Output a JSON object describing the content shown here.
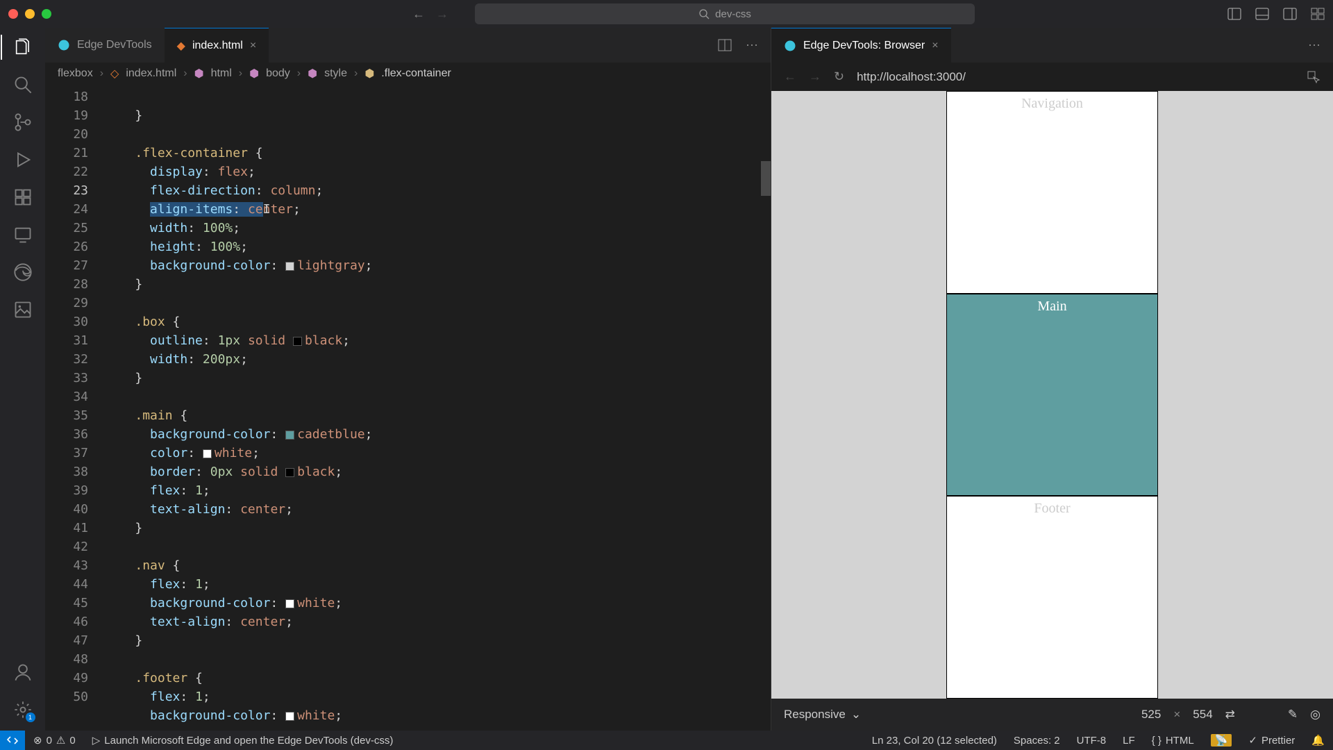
{
  "window": {
    "search_placeholder": "dev-css"
  },
  "tabs": {
    "left1": "Edge DevTools",
    "left2": "index.html",
    "right1": "Edge DevTools: Browser"
  },
  "breadcrumb": {
    "root": "flexbox",
    "file": "index.html",
    "html": "html",
    "body": "body",
    "style": "style",
    "selector": ".flex-container"
  },
  "gutter": [
    "18",
    "19",
    "20",
    "21",
    "22",
    "23",
    "24",
    "25",
    "26",
    "27",
    "28",
    "29",
    "30",
    "31",
    "32",
    "33",
    "34",
    "35",
    "36",
    "37",
    "38",
    "39",
    "40",
    "41",
    "42",
    "43",
    "44",
    "45",
    "46",
    "47",
    "48",
    "49",
    "50"
  ],
  "gutter_hl_index": 5,
  "code": {
    "l18": "    }",
    "l20a": "    ",
    "l20b": ".flex-container",
    "l20c": " {",
    "l21a": "      ",
    "l21p": "display",
    "l21v": "flex",
    "l22p": "flex-direction",
    "l22v": "column",
    "l23p": "align-items",
    "l23v": "center",
    "l24p": "width",
    "l24v": "100%",
    "l25p": "height",
    "l25v": "100%",
    "l26p": "background-color",
    "l26v": "lightgray",
    "l29s": ".box",
    "l30p": "outline",
    "l30v1": "1px",
    "l30v2": "solid",
    "l30v3": "black",
    "l31p": "width",
    "l31v": "200px",
    "l34s": ".main",
    "l35p": "background-color",
    "l35v": "cadetblue",
    "l36p": "color",
    "l36v": "white",
    "l37p": "border",
    "l37v1": "0px",
    "l37v2": "solid",
    "l37v3": "black",
    "l38p": "flex",
    "l38v": "1",
    "l39p": "text-align",
    "l39v": "center",
    "l42s": ".nav",
    "l43p": "flex",
    "l43v": "1",
    "l44p": "background-color",
    "l44v": "white",
    "l45p": "text-align",
    "l45v": "center",
    "l48s": ".footer",
    "l49p": "flex",
    "l49v": "1",
    "l50p": "background-color",
    "l50v": "white"
  },
  "browser": {
    "url": "http://localhost:3000/",
    "nav_label": "Navigation",
    "main_label": "Main",
    "footer_label": "Footer",
    "responsive": "Responsive",
    "width": "525",
    "times": "×",
    "height": "554"
  },
  "status": {
    "errors": "0",
    "warnings": "0",
    "launch": "Launch Microsoft Edge and open the Edge DevTools (dev-css)",
    "cursor": "Ln 23, Col 20 (12 selected)",
    "spaces": "Spaces: 2",
    "encoding": "UTF-8",
    "eol": "LF",
    "lang": "HTML",
    "prettier": "Prettier"
  }
}
